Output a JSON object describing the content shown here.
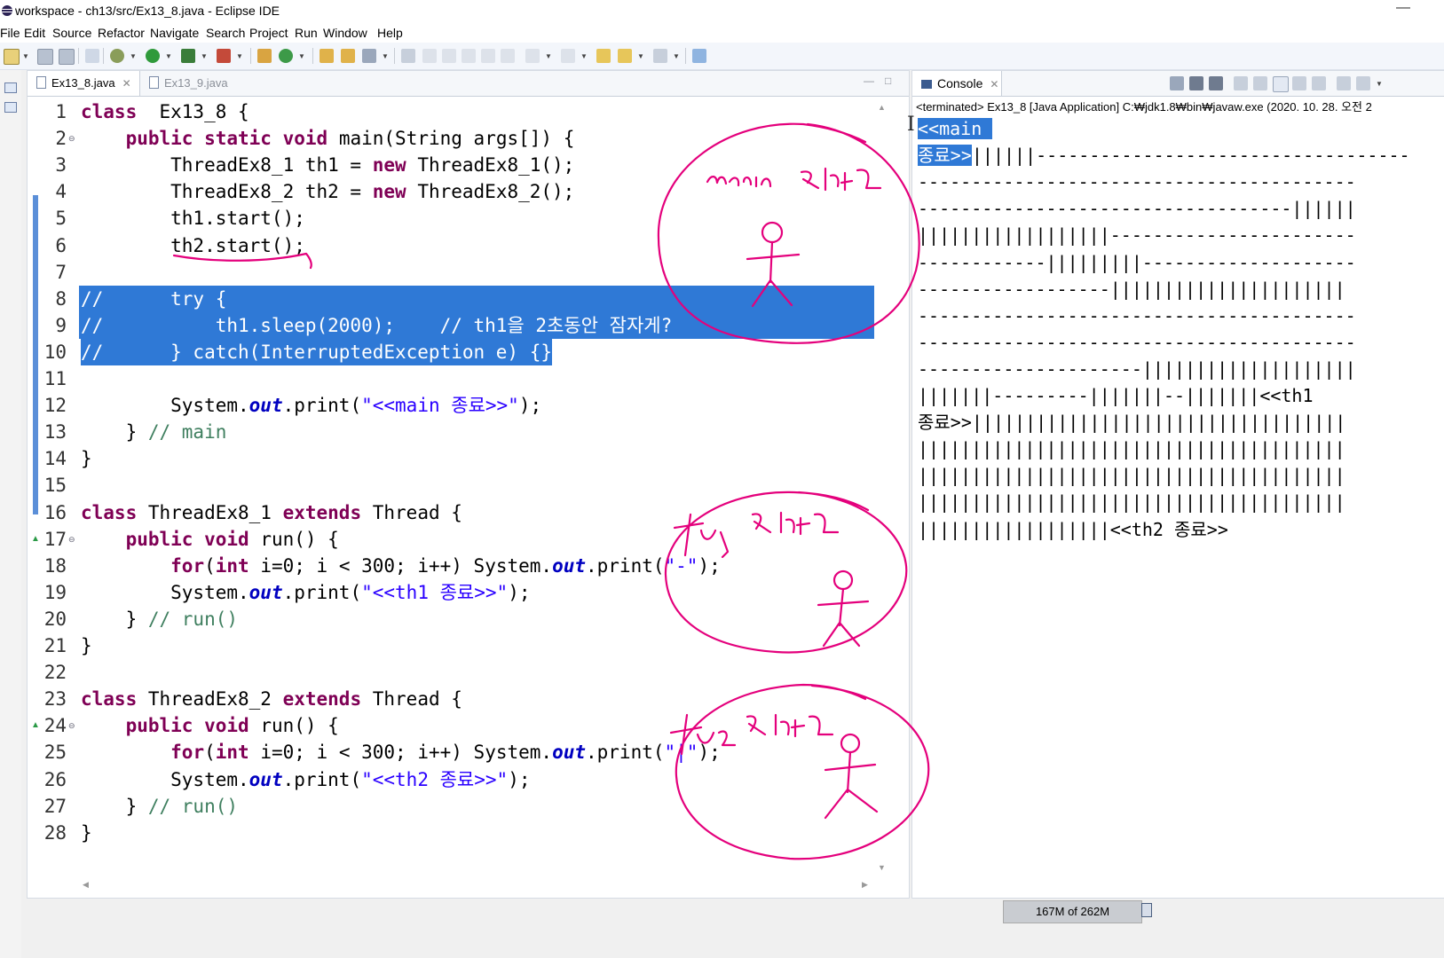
{
  "window": {
    "title": "workspace - ch13/src/Ex13_8.java - Eclipse IDE",
    "minimize": "—"
  },
  "menu": [
    "File",
    "Edit",
    "Source",
    "Refactor",
    "Navigate",
    "Search",
    "Project",
    "Run",
    "Window",
    "Help"
  ],
  "editor": {
    "tabs": [
      {
        "label": "Ex13_8.java",
        "active": true,
        "close": "✕"
      },
      {
        "label": "Ex13_9.java",
        "active": false
      }
    ],
    "minimize": "—",
    "maximize": "□"
  },
  "code_lines": [
    {
      "n": "1",
      "seg": [
        [
          "kw",
          "class"
        ],
        [
          "",
          "  Ex13_8 {"
        ]
      ]
    },
    {
      "n": "2",
      "fold": "⊖",
      "seg": [
        [
          "",
          "    "
        ],
        [
          "kw",
          "public"
        ],
        [
          "",
          " "
        ],
        [
          "kw",
          "static"
        ],
        [
          "",
          " "
        ],
        [
          "kw",
          "void"
        ],
        [
          "",
          " main(String args[]) {"
        ]
      ]
    },
    {
      "n": "3",
      "seg": [
        [
          "",
          "        ThreadEx8_1 th1 = "
        ],
        [
          "kw",
          "new"
        ],
        [
          "",
          " ThreadEx8_1();"
        ]
      ]
    },
    {
      "n": "4",
      "seg": [
        [
          "",
          "        ThreadEx8_2 th2 = "
        ],
        [
          "kw",
          "new"
        ],
        [
          "",
          " ThreadEx8_2();"
        ]
      ]
    },
    {
      "n": "5",
      "seg": [
        [
          "",
          "        th1.start();"
        ]
      ]
    },
    {
      "n": "6",
      "seg": [
        [
          "",
          "        th2.start();"
        ]
      ]
    },
    {
      "n": "7",
      "seg": []
    },
    {
      "n": "8",
      "sel": true,
      "seg": [
        [
          "",
          "//      try {"
        ]
      ]
    },
    {
      "n": "9",
      "sel": true,
      "seg": [
        [
          "",
          "//          th1.sleep(2000);    // th1을 2초동안 잠자게?"
        ]
      ]
    },
    {
      "n": "10",
      "sel": true,
      "partial": true,
      "seg": [
        [
          "",
          "//      } catch(InterruptedException e) {}"
        ]
      ]
    },
    {
      "n": "11",
      "seg": []
    },
    {
      "n": "12",
      "seg": [
        [
          "",
          "        System."
        ],
        [
          "fi",
          "out"
        ],
        [
          "",
          ".print("
        ],
        [
          "st",
          "\"<<main 종료>>\""
        ],
        [
          "",
          ");"
        ]
      ]
    },
    {
      "n": "13",
      "seg": [
        [
          "",
          "    } "
        ],
        [
          "cm",
          "// main"
        ]
      ]
    },
    {
      "n": "14",
      "seg": [
        [
          "",
          "}"
        ]
      ]
    },
    {
      "n": "15",
      "seg": []
    },
    {
      "n": "16",
      "seg": [
        [
          "kw",
          "class"
        ],
        [
          "",
          " ThreadEx8_1 "
        ],
        [
          "kw",
          "extends"
        ],
        [
          "",
          " Thread {"
        ]
      ]
    },
    {
      "n": "17",
      "fold": "⊖",
      "marker": "▲",
      "seg": [
        [
          "",
          "    "
        ],
        [
          "kw",
          "public"
        ],
        [
          "",
          " "
        ],
        [
          "kw",
          "void"
        ],
        [
          "",
          " run() {"
        ]
      ]
    },
    {
      "n": "18",
      "seg": [
        [
          "",
          "        "
        ],
        [
          "kw",
          "for"
        ],
        [
          "",
          "("
        ],
        [
          "kw",
          "int"
        ],
        [
          "",
          " i=0; i < 300; i++) System."
        ],
        [
          "fi",
          "out"
        ],
        [
          "",
          ".print("
        ],
        [
          "st",
          "\"-\""
        ],
        [
          "",
          ");"
        ]
      ]
    },
    {
      "n": "19",
      "seg": [
        [
          "",
          "        System."
        ],
        [
          "fi",
          "out"
        ],
        [
          "",
          ".print("
        ],
        [
          "st",
          "\"<<th1 종료>>\""
        ],
        [
          "",
          ");"
        ]
      ]
    },
    {
      "n": "20",
      "seg": [
        [
          "",
          "    } "
        ],
        [
          "cm",
          "// run()"
        ]
      ]
    },
    {
      "n": "21",
      "seg": [
        [
          "",
          "}"
        ]
      ]
    },
    {
      "n": "22",
      "seg": []
    },
    {
      "n": "23",
      "seg": [
        [
          "kw",
          "class"
        ],
        [
          "",
          " ThreadEx8_2 "
        ],
        [
          "kw",
          "extends"
        ],
        [
          "",
          " Thread {"
        ]
      ]
    },
    {
      "n": "24",
      "fold": "⊖",
      "marker": "▲",
      "seg": [
        [
          "",
          "    "
        ],
        [
          "kw",
          "public"
        ],
        [
          "",
          " "
        ],
        [
          "kw",
          "void"
        ],
        [
          "",
          " run() {"
        ]
      ]
    },
    {
      "n": "25",
      "seg": [
        [
          "",
          "        "
        ],
        [
          "kw",
          "for"
        ],
        [
          "",
          "("
        ],
        [
          "kw",
          "int"
        ],
        [
          "",
          " i=0; i < 300; i++) System."
        ],
        [
          "fi",
          "out"
        ],
        [
          "",
          ".print("
        ],
        [
          "st",
          "\"|\""
        ],
        [
          "",
          ");"
        ]
      ]
    },
    {
      "n": "26",
      "seg": [
        [
          "",
          "        System."
        ],
        [
          "fi",
          "out"
        ],
        [
          "",
          ".print("
        ],
        [
          "st",
          "\"<<th2 종료>>\""
        ],
        [
          "",
          ");"
        ]
      ]
    },
    {
      "n": "27",
      "seg": [
        [
          "",
          "    } "
        ],
        [
          "cm",
          "// run()"
        ]
      ]
    },
    {
      "n": "28",
      "seg": [
        [
          "",
          "}"
        ]
      ]
    }
  ],
  "console": {
    "tab": "Console",
    "close": "✕",
    "info": "<terminated> Ex13_8 [Java Application] C:₩jdk1.8₩bin₩javaw.exe (2020. 10. 28. 오전 2",
    "lines": [
      {
        "sel": "<<main ",
        "rest": ""
      },
      {
        "sel": "종료>>",
        "rest": "||||||-----------------------------------"
      },
      {
        "sel": "",
        "rest": "-----------------------------------------"
      },
      {
        "sel": "",
        "rest": "-----------------------------------||||||"
      },
      {
        "sel": "",
        "rest": "||||||||||||||||||-----------------------"
      },
      {
        "sel": "",
        "rest": "------------|||||||||--------------------"
      },
      {
        "sel": "",
        "rest": "------------------||||||||||||||||||||||"
      },
      {
        "sel": "",
        "rest": "-----------------------------------------"
      },
      {
        "sel": "",
        "rest": "-----------------------------------------"
      },
      {
        "sel": "",
        "rest": "---------------------||||||||||||||||||||"
      },
      {
        "sel": "",
        "rest": "|||||||---------|||||||--|||||||<<th1"
      },
      {
        "sel": "",
        "rest": "종료>>|||||||||||||||||||||||||||||||||||"
      },
      {
        "sel": "",
        "rest": "||||||||||||||||||||||||||||||||||||||||"
      },
      {
        "sel": "",
        "rest": "||||||||||||||||||||||||||||||||||||||||"
      },
      {
        "sel": "",
        "rest": "||||||||||||||||||||||||||||||||||||||||"
      },
      {
        "sel": "",
        "rest": "||||||||||||||||||<<th2 종료>>"
      }
    ]
  },
  "status": {
    "memory": "167M of 262M"
  },
  "colors": {
    "keyword": "#7f0055",
    "string": "#2a00ff",
    "comment": "#3f7f5f",
    "field": "#0000c0",
    "selection": "#2f79d6",
    "annotation_ink": "#e4007c"
  }
}
